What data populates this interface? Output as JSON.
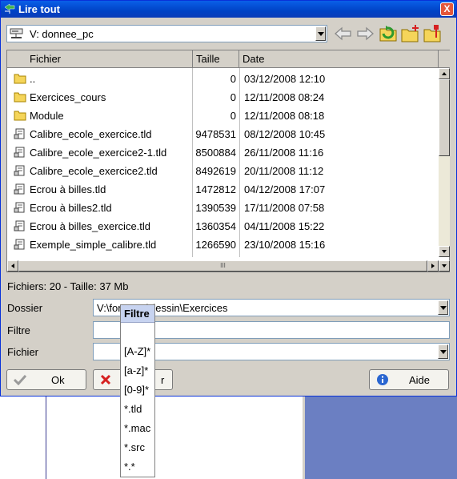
{
  "window": {
    "title": "Lire tout",
    "close_label": "X"
  },
  "drive": {
    "label": "V: donnee_pc"
  },
  "toolbar": {
    "icons": [
      "back-arrow-icon",
      "forward-arrow-icon",
      "refresh-folder-icon",
      "new-folder-icon",
      "folder-properties-icon"
    ]
  },
  "columns": {
    "name": "Fichier",
    "size": "Taille",
    "date": "Date"
  },
  "files": [
    {
      "name": "..",
      "size": "0",
      "date": "03/12/2008 12:10",
      "type": "folder"
    },
    {
      "name": "Exercices_cours",
      "size": "0",
      "date": "12/11/2008 08:24",
      "type": "folder"
    },
    {
      "name": "Module",
      "size": "0",
      "date": "12/11/2008 08:18",
      "type": "folder"
    },
    {
      "name": "Calibre_ecole_exercice.tld",
      "size": "9478531",
      "date": "08/12/2008 10:45",
      "type": "file"
    },
    {
      "name": "Calibre_ecole_exercice2-1.tld",
      "size": "8500884",
      "date": "26/11/2008 11:16",
      "type": "file"
    },
    {
      "name": "Calibre_ecole_exercice2.tld",
      "size": "8492619",
      "date": "20/11/2008 11:12",
      "type": "file"
    },
    {
      "name": "Ecrou à billes.tld",
      "size": "1472812",
      "date": "04/12/2008 17:07",
      "type": "file"
    },
    {
      "name": "Ecrou à billes2.tld",
      "size": "1390539",
      "date": "17/11/2008 07:58",
      "type": "file"
    },
    {
      "name": "Ecrou à billes_exercice.tld",
      "size": "1360354",
      "date": "04/11/2008 15:22",
      "type": "file"
    },
    {
      "name": "Exemple_simple_calibre.tld",
      "size": "1266590",
      "date": "23/10/2008 15:16",
      "type": "file"
    }
  ],
  "scroll": {
    "hthumb_label": "III"
  },
  "status": "Fichiers: 20 - Taille: 37 Mb",
  "form": {
    "dossier_label": "Dossier",
    "dossier_value": "V:\\for          MEP\\dessin\\Exercices",
    "filtre_label": "Filtre",
    "filtre_value": "",
    "fichier_label": "Fichier",
    "fichier_value": ""
  },
  "buttons": {
    "ok": "Ok",
    "cancel": "r",
    "help": "Aide"
  },
  "filter_menu": {
    "title": "Filtre",
    "options": [
      "[A-Z]*",
      "[a-z]*",
      "[0-9]*",
      "*.tld",
      "*.mac",
      "*.src",
      "*.*"
    ]
  },
  "colors": {
    "titlebar": "#0a5fe8",
    "folder": "#f5d55a",
    "desktop": "#6b7fc2"
  }
}
